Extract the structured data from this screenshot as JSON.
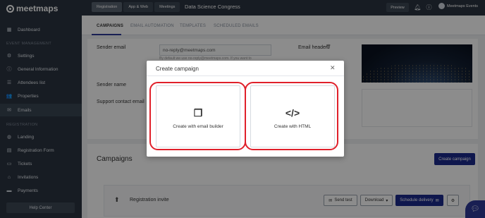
{
  "sidebar": {
    "logo": "meetmaps",
    "items": [
      {
        "label": "Dashboard",
        "icon": "dashboard-icon"
      },
      {
        "label": "Settings",
        "icon": "gear-icon"
      },
      {
        "label": "General Information",
        "icon": "info-icon"
      },
      {
        "label": "Attendees list",
        "icon": "list-icon"
      },
      {
        "label": "Properties",
        "icon": "users-icon"
      },
      {
        "label": "Emails",
        "icon": "mail-icon"
      },
      {
        "label": "Landing",
        "icon": "globe-icon"
      },
      {
        "label": "Registration Form",
        "icon": "form-icon"
      },
      {
        "label": "Tickets",
        "icon": "ticket-icon"
      },
      {
        "label": "Invitations",
        "icon": "invitation-icon"
      },
      {
        "label": "Payments",
        "icon": "card-icon"
      }
    ],
    "section_event": "EVENT MANAGEMENT",
    "section_registration": "REGISTRATION",
    "help_button": "Help Center"
  },
  "topbar": {
    "tabs": [
      "Registration",
      "App & Web",
      "Meetings"
    ],
    "event_name": "Data Science Congress",
    "preview": "Preview",
    "user": "Meetmaps Events"
  },
  "subtabs": [
    "CAMPAIGNS",
    "EMAIL AUTOMATION",
    "TEMPLATES",
    "SCHEDULED EMAILS"
  ],
  "form": {
    "sender_email_label": "Sender email",
    "sender_email_value": "no-reply@meetmaps.com",
    "helper": "By default we use no-reply@meetmaps.com. If you want to",
    "sender_name_label": "Sender name",
    "support_label": "Support contact email",
    "email_header_label": "Email header"
  },
  "campaigns": {
    "title": "Campaigns",
    "create_button": "Create campaign",
    "row": {
      "name": "Registration invite",
      "send_test": "Send test",
      "download": "Download",
      "schedule": "Schedule delivery"
    }
  },
  "modal": {
    "title": "Create campaign",
    "options": [
      {
        "label": "Create with email builder",
        "icon": "copy-icon"
      },
      {
        "label": "Create with HTML",
        "icon": "code-icon"
      }
    ]
  },
  "colors": {
    "sidebar": "#2b3440",
    "accent": "#1c2a8c",
    "highlight": "#e0202a"
  }
}
